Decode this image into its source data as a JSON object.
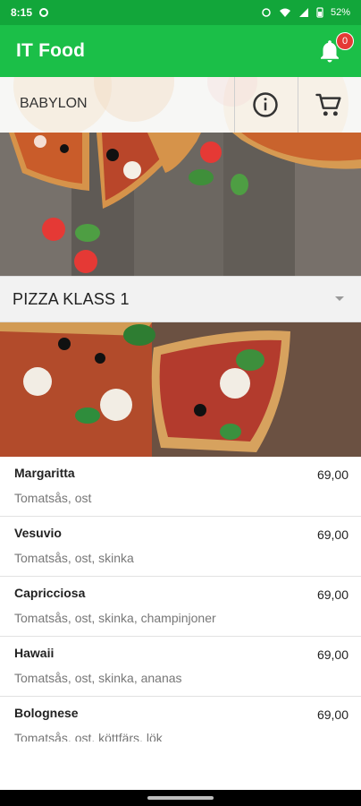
{
  "status_bar": {
    "time": "8:15",
    "battery": "52%"
  },
  "app_bar": {
    "title": "IT Food",
    "notification_count": "0"
  },
  "restaurant_bar": {
    "name": "BABYLON"
  },
  "category": {
    "title": "PIZZA KLASS 1"
  },
  "menu": {
    "items": [
      {
        "name": "Margaritta",
        "desc": "Tomatsås, ost",
        "price": "69,00"
      },
      {
        "name": "Vesuvio",
        "desc": "Tomatsås, ost, skinka",
        "price": "69,00"
      },
      {
        "name": "Capricciosa",
        "desc": "Tomatsås, ost, skinka, champinjoner",
        "price": "69,00"
      },
      {
        "name": "Hawaii",
        "desc": "Tomatsås, ost, skinka, ananas",
        "price": "69,00"
      },
      {
        "name": "Bolognese",
        "desc": "Tomatsås, ost, köttfärs, lök",
        "price": "69,00"
      }
    ]
  },
  "icons": {
    "bell": "bell-icon",
    "info": "info-icon",
    "cart": "cart-icon",
    "dropdown": "chevron-down-icon"
  },
  "colors": {
    "primary_green": "#1bbf48",
    "status_green": "#12a63a",
    "badge_red": "#e53935"
  }
}
